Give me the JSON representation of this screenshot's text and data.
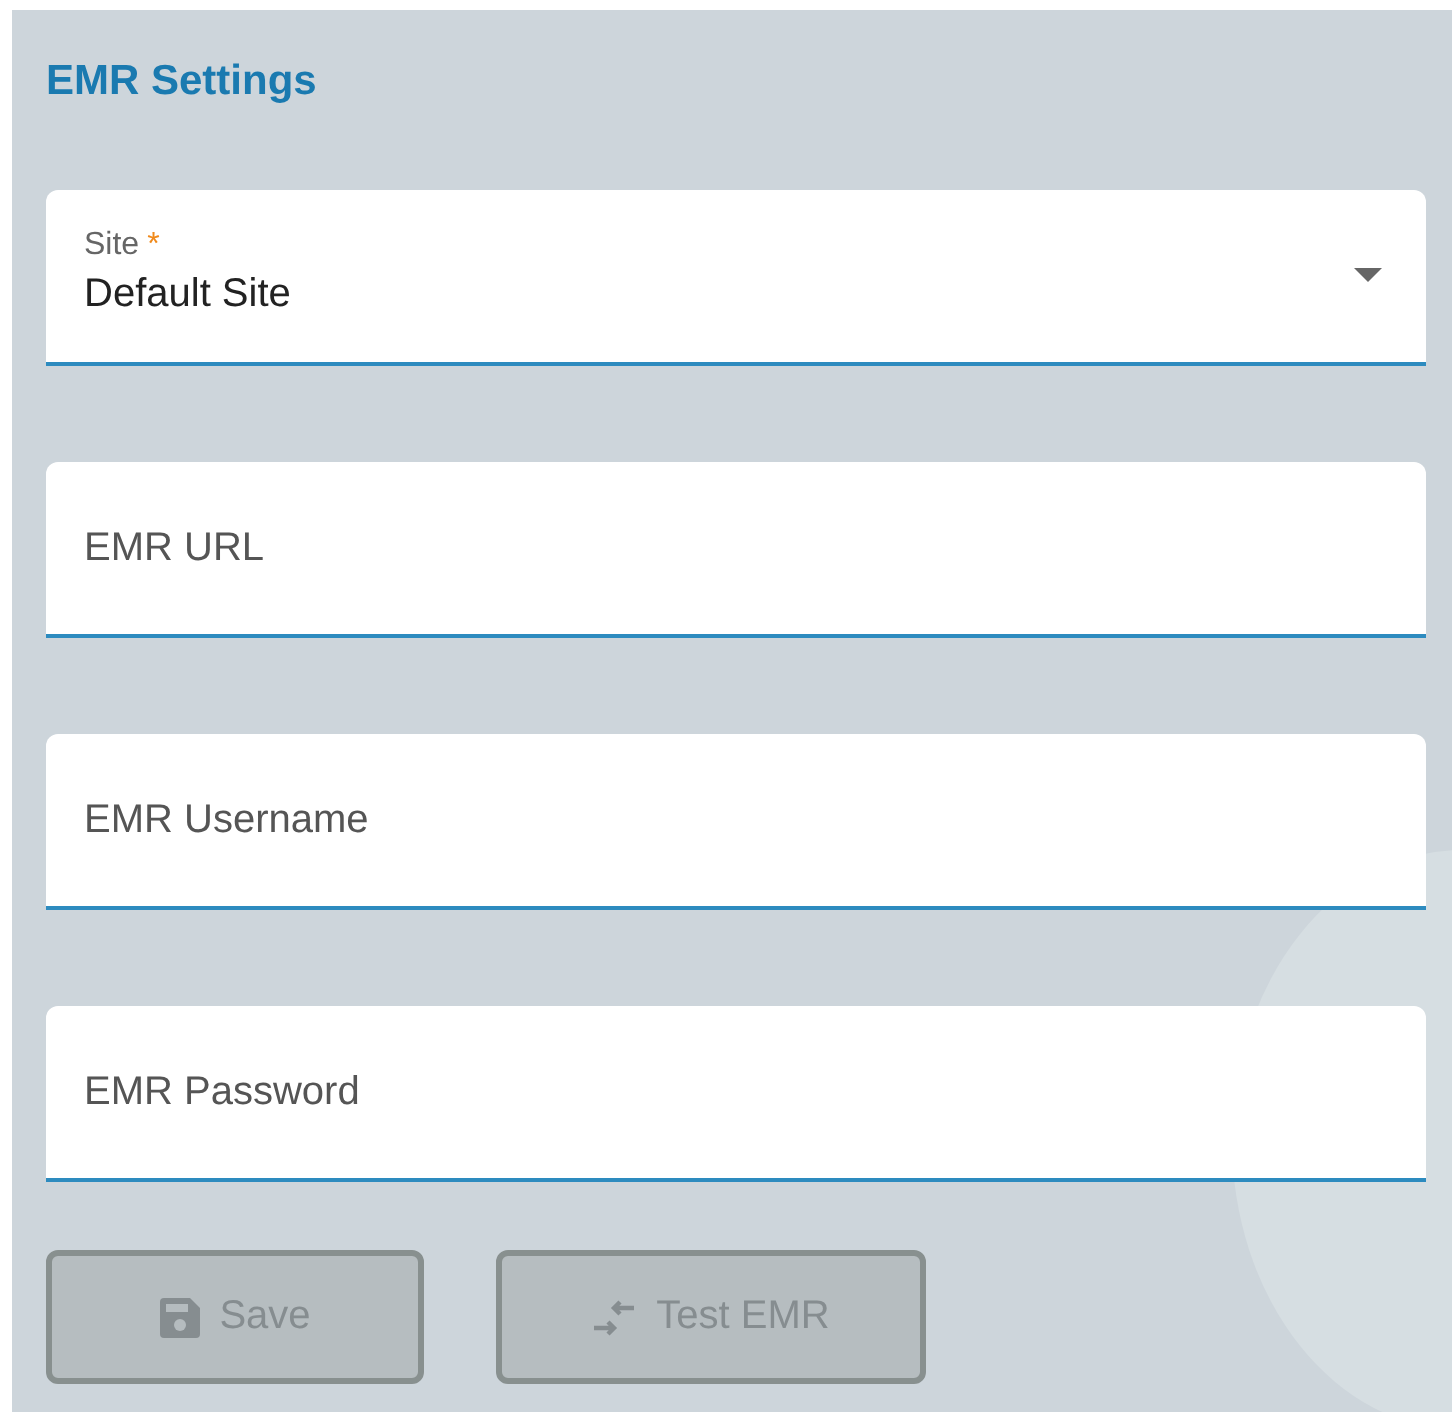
{
  "title": "EMR Settings",
  "fields": [
    {
      "kind": "select",
      "label": "Site",
      "required": true,
      "required_mark": "*",
      "value": "Default Site"
    },
    {
      "kind": "text",
      "placeholder": "EMR URL"
    },
    {
      "kind": "text",
      "placeholder": "EMR Username"
    },
    {
      "kind": "password",
      "placeholder": "EMR Password"
    }
  ],
  "buttons": [
    {
      "kind": "save",
      "label": "Save",
      "disabled": true
    },
    {
      "kind": "test",
      "label": "Test EMR",
      "disabled": true
    }
  ]
}
